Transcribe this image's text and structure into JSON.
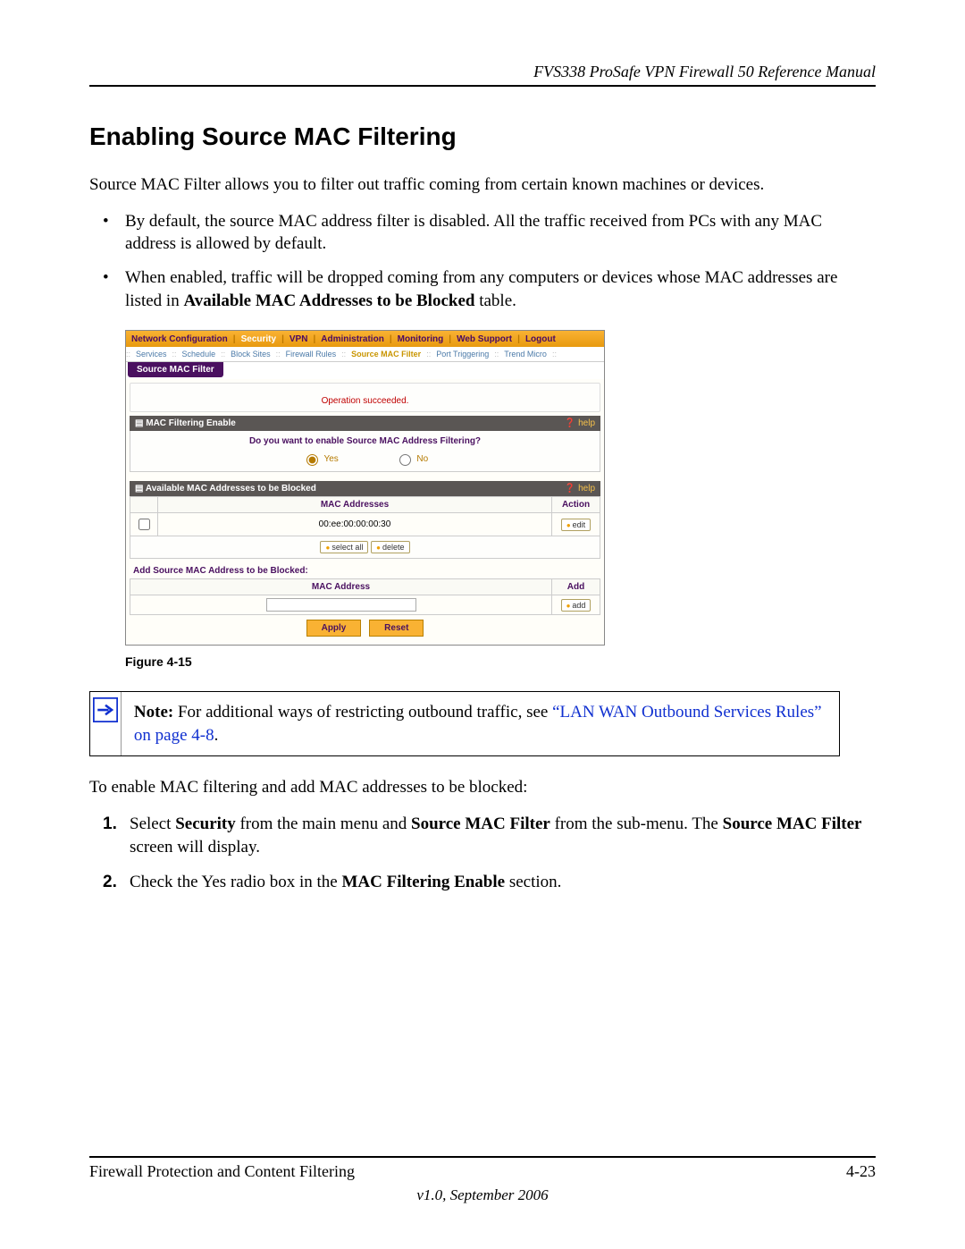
{
  "header": {
    "manual_title": "FVS338 ProSafe VPN Firewall 50 Reference Manual"
  },
  "section": {
    "title": "Enabling Source MAC Filtering",
    "intro": "Source MAC Filter allows you to filter out traffic coming from certain known machines or devices.",
    "bullets": [
      "By default, the source MAC address filter is disabled. All the traffic received from PCs with any MAC address is allowed by default.",
      {
        "pre": "When enabled, traffic will be dropped coming from any computers or devices whose MAC addresses are listed in ",
        "bold": "Available MAC Addresses to be Blocked",
        "post": " table."
      }
    ]
  },
  "screenshot": {
    "main_menu": [
      "Network Configuration",
      "Security",
      "VPN",
      "Administration",
      "Monitoring",
      "Web Support",
      "Logout"
    ],
    "main_menu_active": "Security",
    "sub_menu": [
      "Services",
      "Schedule",
      "Block Sites",
      "Firewall Rules",
      "Source MAC Filter",
      "Port Triggering",
      "Trend Micro"
    ],
    "sub_menu_active": "Source MAC Filter",
    "tab_label": "Source MAC Filter",
    "status_message": "Operation succeeded.",
    "panel1": {
      "title": "MAC Filtering Enable",
      "help": "help",
      "question": "Do you want to enable Source MAC Address Filtering?",
      "option_yes": "Yes",
      "option_no": "No",
      "selected": "yes"
    },
    "panel2": {
      "title": "Available MAC Addresses to be Blocked",
      "help": "help",
      "col_mac": "MAC Addresses",
      "col_action": "Action",
      "rows": [
        {
          "mac": "00:ee:00:00:00:30",
          "action": "edit"
        }
      ],
      "btn_select_all": "select all",
      "btn_delete": "delete"
    },
    "panel3": {
      "sub_heading": "Add Source MAC Address to be Blocked:",
      "col_mac": "MAC Address",
      "col_add": "Add",
      "btn_add": "add",
      "input_value": ""
    },
    "btn_apply": "Apply",
    "btn_reset": "Reset"
  },
  "figure_label": "Figure 4-15",
  "note": {
    "prefix": "Note:",
    "text": " For additional ways of restricting outbound traffic, see ",
    "link": "“LAN WAN Outbound Services Rules” on page 4-8",
    "suffix": "."
  },
  "steps_intro": "To enable MAC filtering and add MAC addresses to be blocked:",
  "steps": [
    {
      "parts": [
        {
          "t": "Select "
        },
        {
          "b": "Security"
        },
        {
          "t": " from the main menu and "
        },
        {
          "b": "Source MAC Filter"
        },
        {
          "t": " from the sub-menu. The "
        },
        {
          "b": "Source MAC Filter"
        },
        {
          "t": " screen will display."
        }
      ]
    },
    {
      "parts": [
        {
          "t": "Check the Yes radio box in the "
        },
        {
          "b": "MAC Filtering Enable"
        },
        {
          "t": " section."
        }
      ]
    }
  ],
  "footer": {
    "chapter": "Firewall Protection and Content Filtering",
    "page": "4-23",
    "version": "v1.0, September 2006"
  }
}
